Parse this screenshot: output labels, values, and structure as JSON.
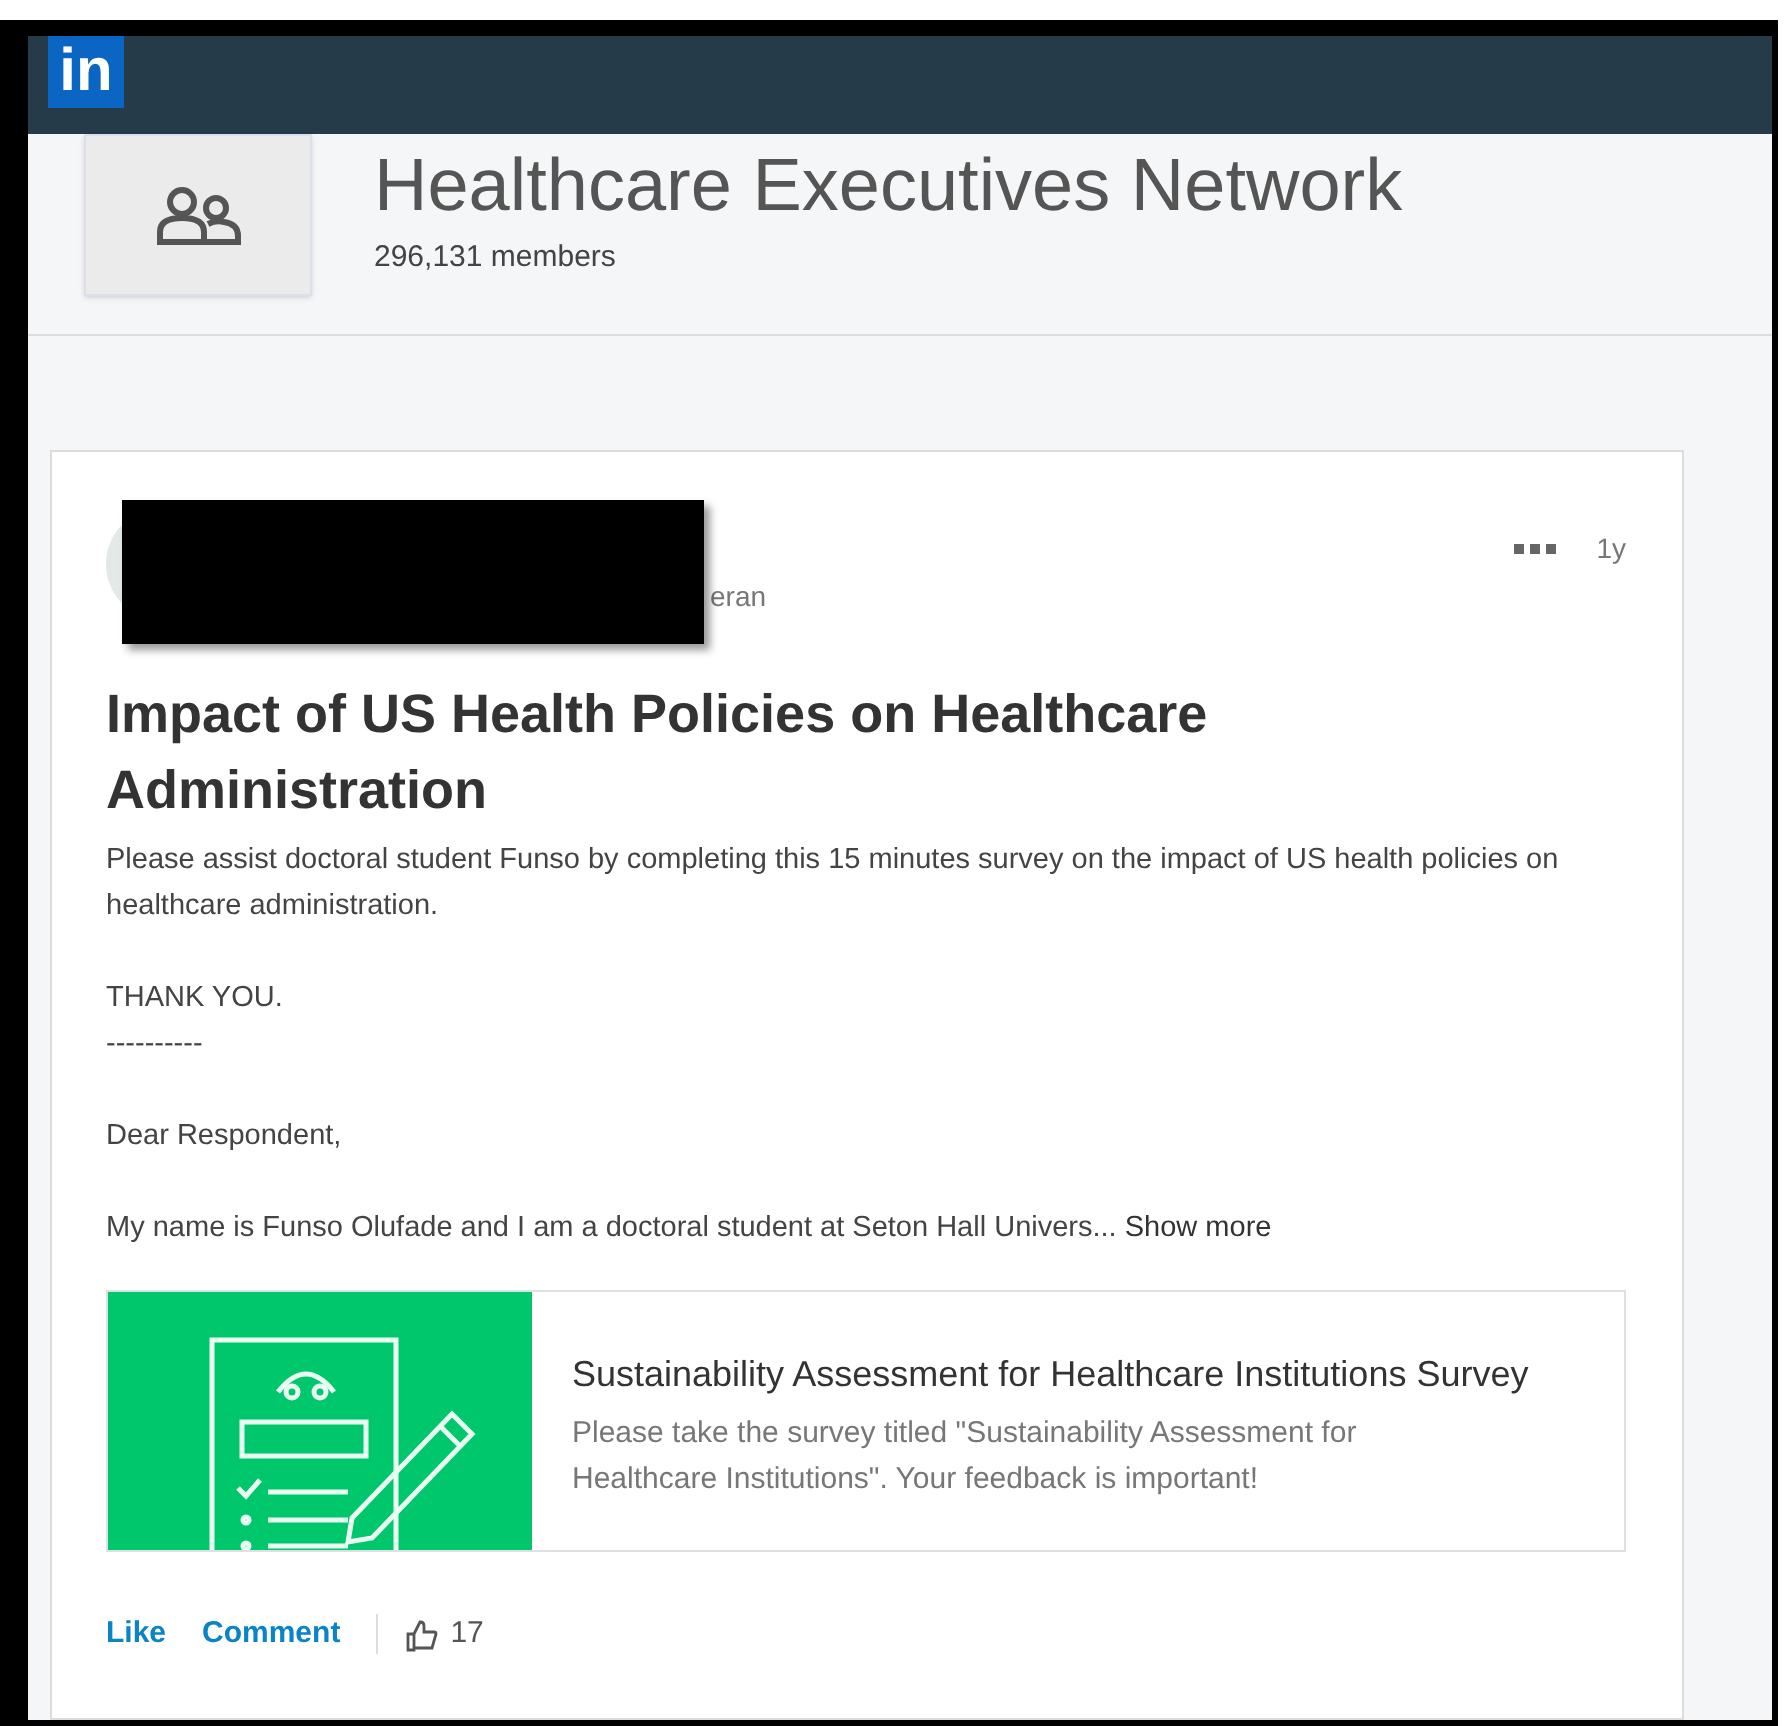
{
  "header": {
    "logo": "in"
  },
  "group": {
    "name": "Healthcare Executives Network",
    "members": "296,131 members"
  },
  "post": {
    "author_fragment": "eran",
    "time": "1y",
    "title": "Impact of US Health Policies on Healthcare Administration",
    "paragraphs": [
      "Please assist doctoral student Funso by completing this 15 minutes survey on the impact of US health policies on healthcare administration.",
      "THANK YOU.\n----------",
      "Dear Respondent,"
    ],
    "last_line": "My name is Funso Olufade and I am a doctoral student at Seton Hall Univers...",
    "show_more": "Show more",
    "link": {
      "title": "Sustainability Assessment for Healthcare Institutions Survey",
      "description": "Please take the survey titled \"Sustainability Assessment for Healthcare Institutions\". Your feedback is important!"
    },
    "actions": [
      "Like",
      "Comment"
    ],
    "likes": "17"
  }
}
